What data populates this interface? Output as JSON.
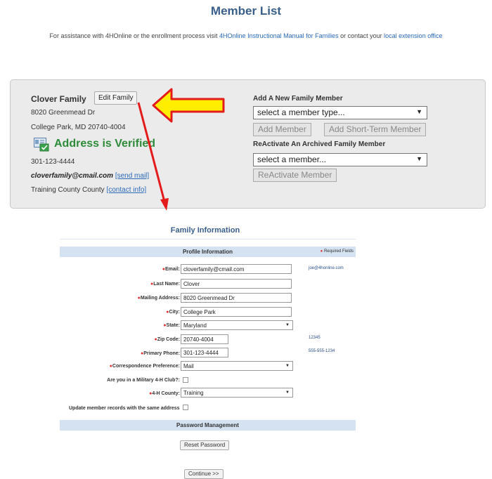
{
  "page": {
    "title": "Member List"
  },
  "assistance": {
    "prefix": "For assistance with 4HOnline or the enrollment process visit ",
    "manual_link": "4HOnline Instructional Manual for Families",
    "middle": " or contact your ",
    "office_link": "local extension office"
  },
  "family": {
    "name": "Clover Family",
    "edit_label": "Edit Family",
    "street": "8020 Greenmead Dr",
    "city_line": "College Park, MD 20740-4004",
    "verified_text": "Address is Verified",
    "phone": "301-123-4444",
    "email": "cloverfamily@cmail.com",
    "send_mail_link": "[send mail]",
    "county": "Training County County",
    "contact_info_link": "[contact info]"
  },
  "add_member": {
    "heading": "Add A New Family Member",
    "member_type_value": "select a member type...",
    "add_member_label": "Add Member",
    "add_short_term_label": "Add Short-Term Member"
  },
  "reactivate": {
    "heading": "ReActivate An Archived Family Member",
    "member_value": "select a member...",
    "reactivate_label": "ReActivate Member"
  },
  "family_info": {
    "title": "Family Information",
    "profile_heading": "Profile Information",
    "required_note": "Required Fields",
    "fields": {
      "email_label": "Email:",
      "email_value": "cloverfamily@cmail.com",
      "email_hint": "joe@4honline.com",
      "last_name_label": "Last Name:",
      "last_name_value": "Clover",
      "mailing_label": "Mailing Address:",
      "mailing_value": "8020 Greenmead Dr",
      "city_label": "City:",
      "city_value": "College Park",
      "state_label": "State:",
      "state_value": "Maryland",
      "zip_label": "Zip Code:",
      "zip_value": "20740-4004",
      "zip_hint": "12345",
      "phone_label": "Primary Phone:",
      "phone_value": "301-123-4444",
      "phone_hint": "555-555-1234",
      "corr_label": "Correspondence Preference:",
      "corr_value": "Mail",
      "military_label": "Are you in a Military 4-H Club?:",
      "county_label": "4-H County:",
      "county_value": "Training",
      "update_label": "Update member records with the same address"
    },
    "password_heading": "Password Management",
    "reset_label": "Reset Password",
    "continue_label": "Continue >>"
  },
  "colors": {
    "title_blue": "#3a5f8a",
    "link_blue": "#2a6ab8",
    "verified_green": "#2e8b3a",
    "bar_blue": "#d4e2f2",
    "arrow_red": "#e31b1b",
    "arrow_yellow": "#ffee00"
  }
}
